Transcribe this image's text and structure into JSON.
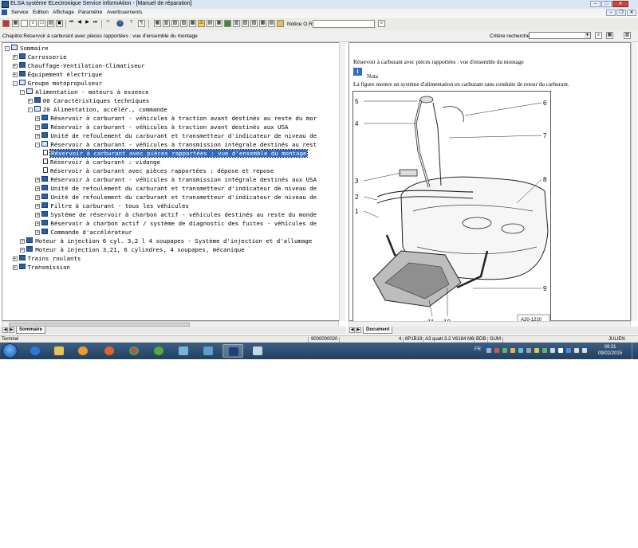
{
  "window": {
    "title": "ELSA système ELectronique Service informAtion - [Manuel de réparation]"
  },
  "menu": [
    "Service",
    "Edition",
    "Affichage",
    "Paramètre",
    "Avertissements"
  ],
  "toolbar": {
    "notice_label": "Notice O.R.:",
    "notice_value": ""
  },
  "chapter": {
    "text": "Chapitre:Réservoir à carburant avec pièces rapportées : vue d'ensemble du montage",
    "criteria_label": "Critère recherche:",
    "criteria_value": ""
  },
  "tree": [
    {
      "label": "Sommaire",
      "indent": 0,
      "toggle": "-",
      "icon": "book-open"
    },
    {
      "label": "Carrosserie",
      "indent": 1,
      "toggle": "+",
      "icon": "book"
    },
    {
      "label": "Chauffage-Ventilation-Climatiseur",
      "indent": 1,
      "toggle": "+",
      "icon": "book"
    },
    {
      "label": "Équipement électrique",
      "indent": 1,
      "toggle": "+",
      "icon": "book"
    },
    {
      "label": "Groupe motopropulseur",
      "indent": 1,
      "toggle": "-",
      "icon": "book-open"
    },
    {
      "label": "Alimentation - moteurs à essence",
      "indent": 2,
      "toggle": "-",
      "icon": "book-open"
    },
    {
      "label": "00 Caractéristiques techniques",
      "indent": 3,
      "toggle": "+",
      "icon": "book"
    },
    {
      "label": "20 Alimentation, accélér., commande",
      "indent": 3,
      "toggle": "-",
      "icon": "book-open"
    },
    {
      "label": "Réservoir à carburant - véhicules à traction avant destinés au reste du mor",
      "indent": 4,
      "toggle": "+",
      "icon": "book"
    },
    {
      "label": "Réservoir à carburant - véhicules à traction avant destinés aux USA",
      "indent": 4,
      "toggle": "+",
      "icon": "book"
    },
    {
      "label": "Unité de refoulement du carburant et transmetteur d'indicateur de niveau de",
      "indent": 4,
      "toggle": "+",
      "icon": "book"
    },
    {
      "label": "Réservoir à carburant - véhicules à transmission intégrale destinés au rest",
      "indent": 4,
      "toggle": "-",
      "icon": "book-open"
    },
    {
      "label": "Réservoir à carburant avec pièces rapportées : vue d'ensemble du montage",
      "indent": 5,
      "toggle": "",
      "icon": "page",
      "selected": true
    },
    {
      "label": "Réservoir à carburant : vidange",
      "indent": 5,
      "toggle": "",
      "icon": "page"
    },
    {
      "label": "Réservoir à carburant avec pièces rapportées : dépose et repose",
      "indent": 5,
      "toggle": "",
      "icon": "page"
    },
    {
      "label": "Réservoir à carburant - véhicules à transmission intégrale destinés aux USA",
      "indent": 4,
      "toggle": "+",
      "icon": "book"
    },
    {
      "label": "Unité de refoulement du carburant et transmetteur d'indicateur de niveau de",
      "indent": 4,
      "toggle": "+",
      "icon": "book"
    },
    {
      "label": "Unité de refoulement du carburant et transmetteur d'indicateur de niveau de",
      "indent": 4,
      "toggle": "+",
      "icon": "book"
    },
    {
      "label": "Filtre à carburant - tous les véhicules",
      "indent": 4,
      "toggle": "+",
      "icon": "book"
    },
    {
      "label": "Système de réservoir à charbon actif - véhicules destinés au reste du monde",
      "indent": 4,
      "toggle": "+",
      "icon": "book"
    },
    {
      "label": "Réservoir à charbon actif / système de diagnostic des fuites - véhicules de",
      "indent": 4,
      "toggle": "+",
      "icon": "book"
    },
    {
      "label": "Commande d'accélérateur",
      "indent": 4,
      "toggle": "+",
      "icon": "book"
    },
    {
      "label": "Moteur à injection 6 cyl. 3,2 l 4 soupapes - Système d'injection et d'allumage",
      "indent": 2,
      "toggle": "+",
      "icon": "book"
    },
    {
      "label": "Moteur à injection 3,21, 6 cylindres, 4 soupapes, mécanique",
      "indent": 2,
      "toggle": "+",
      "icon": "book"
    },
    {
      "label": "Trains roulants",
      "indent": 1,
      "toggle": "+",
      "icon": "book"
    },
    {
      "label": "Transmission",
      "indent": 1,
      "toggle": "+",
      "icon": "book"
    }
  ],
  "document": {
    "heading": "Réservoir à carburant avec pièces rapportées : vue d'ensemble du montage",
    "note_label": "Nota",
    "note_text": "La figure montre un système d'alimentation en carburant sans conduite de retour du carburant.",
    "figure_code": "A20-1210",
    "callouts": [
      "5",
      "4",
      "3",
      "2",
      "1",
      "6",
      "7",
      "8",
      "9",
      "11",
      "10"
    ]
  },
  "tabs": {
    "left": "Sommaire",
    "right": "Document"
  },
  "status": {
    "left": "Terminé",
    "code": "9000000020",
    "num": "4",
    "model_code": "8P1B19",
    "model": "A3 quatt.3.2 V6184 M6",
    "gearbox": "BDB",
    "market": "GUM",
    "user": "JULIEN"
  },
  "taskbar": {
    "lang": "FR",
    "time": "09:31",
    "date": "09/02/2015",
    "apps": [
      "ie",
      "explorer",
      "media",
      "firefox",
      "chrome",
      "utorrent",
      "app1",
      "app2",
      "elsa",
      "app3"
    ]
  },
  "colors": {
    "selection": "#316ac5",
    "book_icon": "#2e5ea8",
    "taskbar": "#2c4a6e"
  }
}
